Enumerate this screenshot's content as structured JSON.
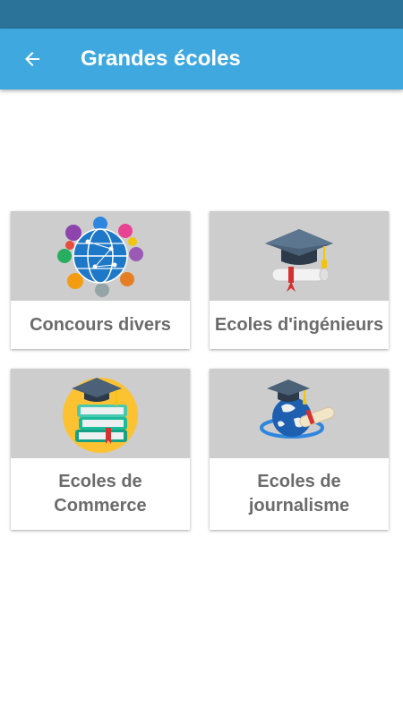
{
  "app_bar": {
    "title": "Grandes écoles",
    "back_icon": "arrow-left-icon"
  },
  "colors": {
    "status_bar": "#2c7399",
    "app_bar": "#3fa8df",
    "card_image_bg": "#cdcdcd",
    "card_label": "#6b6b6b"
  },
  "cards": [
    {
      "label": "Concours divers",
      "icon": "globe-network-icon"
    },
    {
      "label": "Ecoles d'ingénieurs",
      "icon": "graduation-cap-diploma-icon"
    },
    {
      "label": "Ecoles de\nCommerce",
      "icon": "books-cap-icon"
    },
    {
      "label": "Ecoles de\njournalisme",
      "icon": "globe-cap-diploma-icon"
    }
  ]
}
